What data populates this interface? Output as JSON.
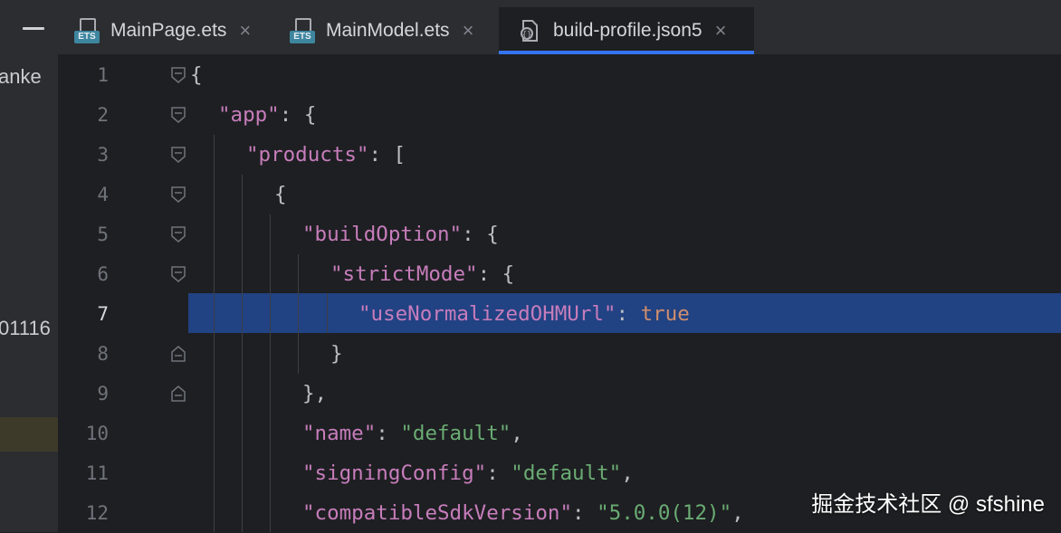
{
  "sidebar": {
    "snippets": [
      "anke",
      "01116"
    ]
  },
  "tabs": [
    {
      "label": "MainPage.ets",
      "icon": "ets-file-icon",
      "badge": "ETS",
      "active": false
    },
    {
      "label": "MainModel.ets",
      "icon": "ets-file-icon",
      "badge": "ETS",
      "active": false
    },
    {
      "label": "build-profile.json5",
      "icon": "json-config-file-icon",
      "active": true
    }
  ],
  "editor": {
    "current_line": 7,
    "lines": [
      {
        "num": "1",
        "code": "{"
      },
      {
        "num": "2",
        "code": "\"app\": {"
      },
      {
        "num": "3",
        "code": "\"products\": ["
      },
      {
        "num": "4",
        "code": "{"
      },
      {
        "num": "5",
        "code": "\"buildOption\": {"
      },
      {
        "num": "6",
        "code": "\"strictMode\": {"
      },
      {
        "num": "7",
        "code": "\"useNormalizedOHMUrl\": true"
      },
      {
        "num": "8",
        "code": "}"
      },
      {
        "num": "9",
        "code": "},"
      },
      {
        "num": "10",
        "code": "\"name\": \"default\","
      },
      {
        "num": "11",
        "code": "\"signingConfig\": \"default\","
      },
      {
        "num": "12",
        "code": "\"compatibleSdkVersion\": \"5.0.0(12)\","
      }
    ]
  },
  "colors": {
    "key": "#c77dbb",
    "string": "#6aab73",
    "boolean": "#cf8e6d",
    "punctuation": "#bcbec4",
    "selection": "#214283",
    "accent": "#3574f0"
  },
  "watermark": "掘金技术社区 @ sfshine"
}
